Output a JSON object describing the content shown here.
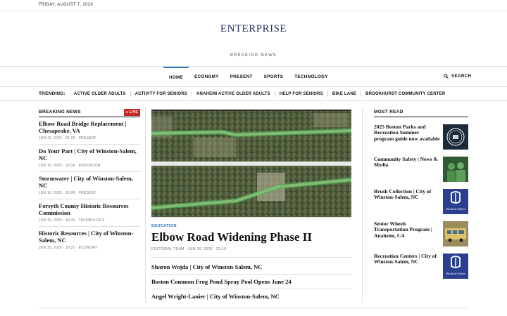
{
  "date": "FRIDAY, AUGUST 7, 2026",
  "logo": "ENTERPRISE",
  "subtitle": "BREAKING NEWS",
  "nav": [
    "HOME",
    "ECONOMY",
    "PRESENT",
    "SPORTS",
    "TECHNOLOGY"
  ],
  "nav_active": "HOME",
  "search_label": "SEARCH",
  "trending": {
    "label": "TRENDING:",
    "items": [
      "ACTIVE OLDER ADULTS",
      "ACTIVITY FOR SENIORS",
      "ANAHEIM ACTIVE OLDER ADULTS",
      "HELP FOR SENIORS",
      "BIKE LANE",
      "BROOKHURST COMMUNITY CENTER"
    ]
  },
  "breaking": {
    "title": "BREAKING NEWS",
    "live": "LIVE",
    "items": [
      {
        "title": "Elbow Road Bridge Replacement | Chesapeake, VA",
        "meta": "JUN 10, 2025 · 21:20 · PRESENT"
      },
      {
        "title": "Do Your Part | City of Winston-Salem, NC",
        "meta": "JUN 10, 2025 · 20:34 · EDUCATION"
      },
      {
        "title": "Stormwater | City of Winston-Salem, NC",
        "meta": "JUN 10, 2025 · 20:26 · PRESENT"
      },
      {
        "title": "Forsyth County Historic Resources Commission",
        "meta": "JUN 10, 2025 · 18:24 · TECHNOLOGY"
      },
      {
        "title": "Historic Resources | City of Winston-Salem, NC",
        "meta": "JUN 10, 2025 · 18:21 · ECONOMY"
      }
    ]
  },
  "feature": {
    "category": "EDUCATION",
    "headline": "Elbow Road Widening Phase II",
    "byline": "EDITORIAL TEAM · JUN 10, 2025 · 22:19",
    "related": [
      "Sharon Wojda | City of Winston-Salem, NC",
      "Boston Common Frog Pond Spray Pool Opens June 24",
      "Angel Wright-Lanier | City of Winston-Salem, NC"
    ]
  },
  "most_read": {
    "title": "MOST READ",
    "items": [
      {
        "title": "2025 Boston Parks and Recreation Summer program guide now available",
        "thumb": "boston-seal"
      },
      {
        "title": "Community Safety | News & Media",
        "thumb": "community-photo"
      },
      {
        "title": "Brush Collection | City of Winston-Salem, NC",
        "thumb": "winston-salem-logo",
        "thumb_text": "Winston-Salem"
      },
      {
        "title": "Senior Wheels Transportation Program | Anaheim, CA",
        "thumb": "bus-photo"
      },
      {
        "title": "Recreation Centers | City of Winston-Salem, NC",
        "thumb": "winston-salem-logo",
        "thumb_text": "Winston-Salem"
      }
    ]
  },
  "colors": {
    "accent": "#2f7fb8",
    "live": "#c62828",
    "logo": "#24325e",
    "ws_blue": "#2a3f8f"
  }
}
